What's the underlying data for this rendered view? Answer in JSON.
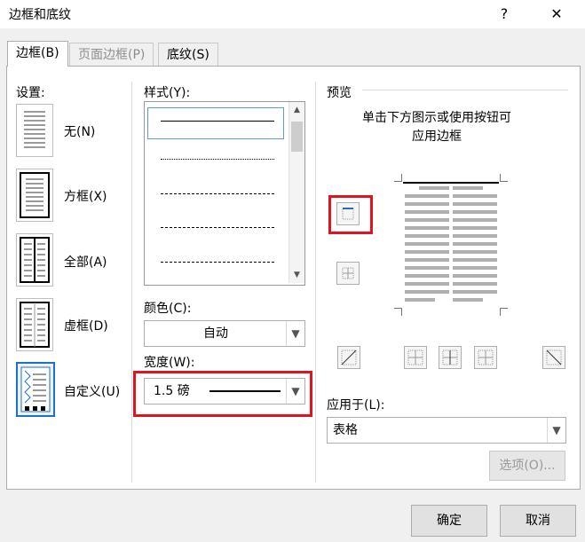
{
  "window": {
    "title": "边框和底纹",
    "help": "?",
    "close": "✕"
  },
  "tabs": [
    {
      "label": "边框(B)",
      "mnemonic": "B"
    },
    {
      "label": "页面边框(P)"
    },
    {
      "label": "底纹(S)"
    }
  ],
  "settings": {
    "label": "设置:",
    "items": [
      {
        "label": "无(N)"
      },
      {
        "label": "方框(X)"
      },
      {
        "label": "全部(A)"
      },
      {
        "label": "虚框(D)"
      },
      {
        "label": "自定义(U)"
      }
    ]
  },
  "style": {
    "label": "样式(Y):"
  },
  "color": {
    "label": "颜色(C):",
    "value": "自动"
  },
  "width": {
    "label": "宽度(W):",
    "value": "1.5 磅"
  },
  "preview": {
    "label": "预览",
    "hint1": "单击下方图示或使用按钮可",
    "hint2": "应用边框"
  },
  "apply_to": {
    "label": "应用于(L):",
    "value": "表格"
  },
  "options_button": "选项(O)...",
  "ok_button": "确定",
  "cancel_button": "取消",
  "colors": {
    "accent": "#1f6fc3",
    "highlight": "#e0141e"
  }
}
